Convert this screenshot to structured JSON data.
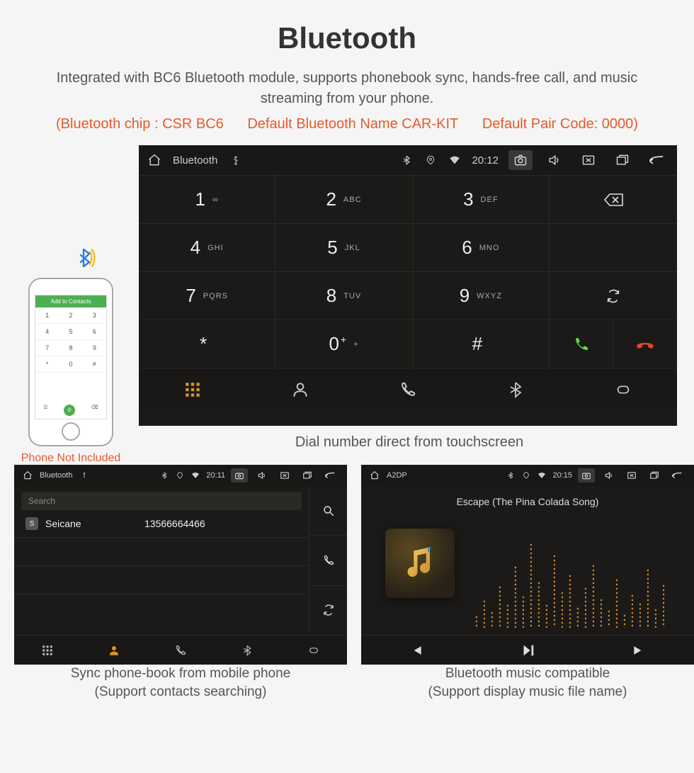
{
  "title": "Bluetooth",
  "description": "Integrated with BC6 Bluetooth module, supports phonebook sync, hands-free call, and music streaming from your phone.",
  "spec": {
    "chip": "(Bluetooth chip : CSR BC6",
    "name": "Default Bluetooth Name CAR-KIT",
    "pair": "Default Pair Code: 0000)"
  },
  "phone_mock": {
    "header": "Add to Contacts",
    "caption": "Phone Not Included"
  },
  "dial_panel": {
    "app_name": "Bluetooth",
    "time": "20:12",
    "keys": [
      {
        "d": "1",
        "l": "∞"
      },
      {
        "d": "2",
        "l": "ABC"
      },
      {
        "d": "3",
        "l": "DEF"
      },
      {
        "d": "4",
        "l": "GHI"
      },
      {
        "d": "5",
        "l": "JKL"
      },
      {
        "d": "6",
        "l": "MNO"
      },
      {
        "d": "7",
        "l": "PQRS"
      },
      {
        "d": "8",
        "l": "TUV"
      },
      {
        "d": "9",
        "l": "WXYZ"
      },
      {
        "d": "*",
        "l": ""
      },
      {
        "d": "0",
        "l": "+",
        "plus": true
      },
      {
        "d": "#",
        "l": ""
      }
    ],
    "caption": "Dial number direct from touchscreen"
  },
  "phonebook_panel": {
    "app_name": "Bluetooth",
    "time": "20:11",
    "search_placeholder": "Search",
    "contact_name": "Seicane",
    "contact_number": "13566664466",
    "caption_l1": "Sync phone-book from mobile phone",
    "caption_l2": "(Support contacts searching)"
  },
  "music_panel": {
    "app_name": "A2DP",
    "time": "20:15",
    "track": "Escape (The Pina Colada Song)",
    "caption_l1": "Bluetooth music compatible",
    "caption_l2": "(Support display music file name)"
  },
  "eq_heights": [
    18,
    40,
    24,
    60,
    34,
    88,
    46,
    120,
    66,
    34,
    104,
    52,
    76,
    30,
    58,
    90,
    42,
    26,
    70,
    20,
    48,
    36,
    84,
    28,
    62
  ]
}
